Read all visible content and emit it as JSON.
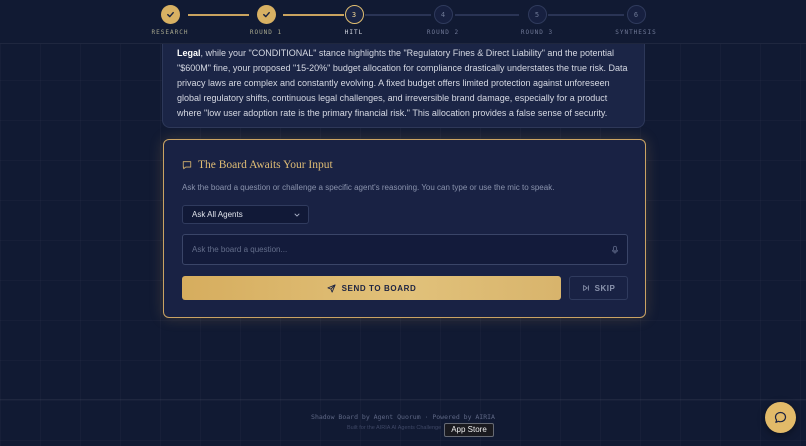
{
  "stepper": {
    "steps": [
      {
        "num": "1",
        "label": "RESEARCH",
        "state": "done"
      },
      {
        "num": "2",
        "label": "ROUND 1",
        "state": "done"
      },
      {
        "num": "3",
        "label": "HITL",
        "state": "active"
      },
      {
        "num": "4",
        "label": "ROUND 2",
        "state": "pending"
      },
      {
        "num": "5",
        "label": "ROUND 3",
        "state": "pending"
      },
      {
        "num": "6",
        "label": "SYNTHESIS",
        "state": "pending"
      }
    ]
  },
  "previous_message": {
    "lead_bold": "Legal",
    "body": ", while your \"CONDITIONAL\" stance highlights the \"Regulatory Fines & Direct Liability\" and the potential \"$600M\" fine, your proposed \"15-20%\" budget allocation for compliance drastically understates the true risk. Data privacy laws are complex and constantly evolving. A fixed budget offers limited protection against unforeseen global regulatory shifts, continuous legal challenges, and irreversible brand damage, especially for a product where \"low user adoption rate is the primary financial risk.\" This allocation provides a false sense of security."
  },
  "board": {
    "title": "The Board Awaits Your Input",
    "subtitle": "Ask the board a question or challenge a specific agent's reasoning. You can type or use the mic to speak.",
    "agent_select_value": "Ask All Agents",
    "question_value": "",
    "question_placeholder": "Ask the board a question...",
    "send_label": "SEND TO BOARD",
    "skip_label": "SKIP"
  },
  "footer": {
    "text": "Shadow Board by Agent Quorum · Powered by AIRIA",
    "subtext": "Built for the AIRIA AI Agents Challenge"
  },
  "tooltip": {
    "text": "App Store"
  },
  "colors": {
    "accent_gold": "#e0bd75",
    "background": "#111a33",
    "card": "#192244"
  },
  "icons": {
    "step_done": "check-icon",
    "board_title": "chat-bubble-icon",
    "select": "chevron-down-icon",
    "question": "mic-icon",
    "send": "send-icon",
    "skip": "skip-forward-icon",
    "fab": "chat-bubble-icon"
  }
}
